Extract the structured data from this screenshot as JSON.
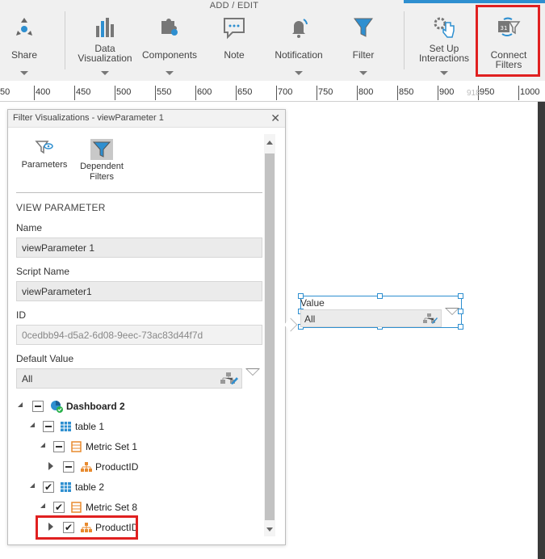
{
  "ribbon": {
    "title": "ADD / EDIT",
    "buttons": [
      {
        "label": "Share",
        "icon": "share-icon"
      },
      {
        "label": "Data\nVisualization",
        "icon": "bar-chart-icon"
      },
      {
        "label": "Components",
        "icon": "puzzle-icon"
      },
      {
        "label": "Note",
        "icon": "note-icon"
      },
      {
        "label": "Notification",
        "icon": "bell-icon"
      },
      {
        "label": "Filter",
        "icon": "funnel-icon"
      },
      {
        "label": "Set Up\nInteractions",
        "icon": "gear-hand-icon"
      },
      {
        "label": "Connect Filters",
        "icon": "connect-filters-icon"
      }
    ]
  },
  "ruler": {
    "ticks": [
      "50",
      "400",
      "450",
      "500",
      "550",
      "600",
      "650",
      "700",
      "750",
      "800",
      "850",
      "900",
      "950",
      "1000"
    ],
    "ghost_label": "918"
  },
  "panel": {
    "title": "Filter Visualizations - viewParameter 1",
    "close_glyph": "✕",
    "tabs": [
      {
        "label": "Parameters",
        "icon": "parameters-icon"
      },
      {
        "label": "Dependent\nFilters",
        "icon": "dependent-filters-icon"
      }
    ],
    "section_heading": "VIEW PARAMETER",
    "name_label": "Name",
    "name_value": "viewParameter 1",
    "script_label": "Script Name",
    "script_value": "viewParameter1",
    "id_label": "ID",
    "id_value": "0cedbb94-d5a2-6d08-9eec-73ac83d44f7d",
    "default_label": "Default Value",
    "default_value": "All",
    "tree": [
      {
        "label": "Dashboard 2",
        "bold": true,
        "check": "partial",
        "expander": "open",
        "icon": "dashboard-icon"
      },
      {
        "label": "table 1",
        "check": "partial",
        "expander": "open",
        "icon": "table-icon"
      },
      {
        "label": "Metric Set 1",
        "check": "partial",
        "expander": "open",
        "icon": "metric-set-icon"
      },
      {
        "label": "ProductID",
        "check": "partial",
        "expander": "closed",
        "icon": "hierarchy-icon"
      },
      {
        "label": "table 2",
        "check": "checked",
        "expander": "open",
        "icon": "table-icon"
      },
      {
        "label": "Metric Set 8",
        "check": "checked",
        "expander": "open",
        "icon": "metric-set-icon"
      },
      {
        "label": "ProductID",
        "check": "checked",
        "expander": "closed",
        "icon": "hierarchy-icon"
      }
    ]
  },
  "canvas_widget": {
    "label": "Value",
    "value": "All"
  },
  "colors": {
    "accent": "#2e8fd0",
    "highlight": "#e02020"
  }
}
